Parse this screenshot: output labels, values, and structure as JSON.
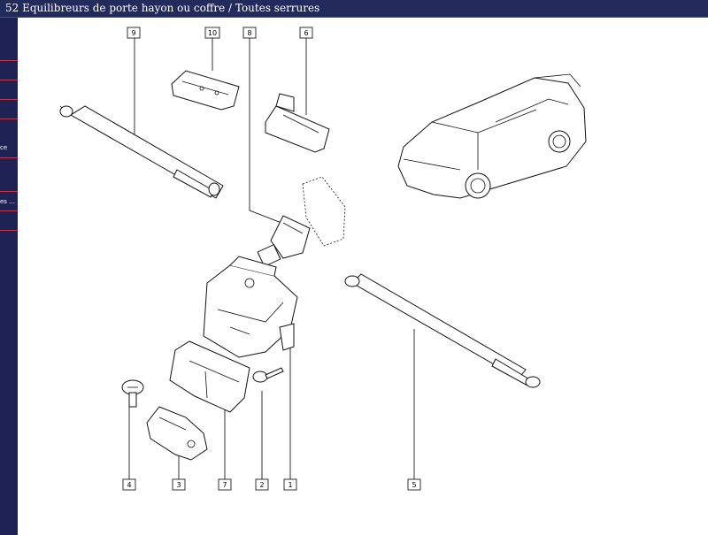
{
  "window": {
    "title": "52 Equilibreurs de porte hayon ou coffre / Toutes serrures"
  },
  "sidebar": {
    "items": [
      {
        "label": ""
      },
      {
        "label": ""
      },
      {
        "label": ""
      },
      {
        "label": ""
      },
      {
        "label": "ce"
      },
      {
        "label": ""
      },
      {
        "label": "es ..."
      },
      {
        "label": ""
      }
    ]
  },
  "diagram": {
    "callouts": [
      {
        "id": "9",
        "label": "9"
      },
      {
        "id": "10",
        "label": "10"
      },
      {
        "id": "8",
        "label": "8"
      },
      {
        "id": "6",
        "label": "6"
      },
      {
        "id": "4",
        "label": "4"
      },
      {
        "id": "3",
        "label": "3"
      },
      {
        "id": "7",
        "label": "7"
      },
      {
        "id": "2",
        "label": "2"
      },
      {
        "id": "1",
        "label": "1"
      },
      {
        "id": "5",
        "label": "5"
      }
    ]
  },
  "colors": {
    "titlebar_bg": "#232a5c",
    "sidebar_bg": "#1f2353",
    "sidebar_separator": "#c23a4a"
  }
}
